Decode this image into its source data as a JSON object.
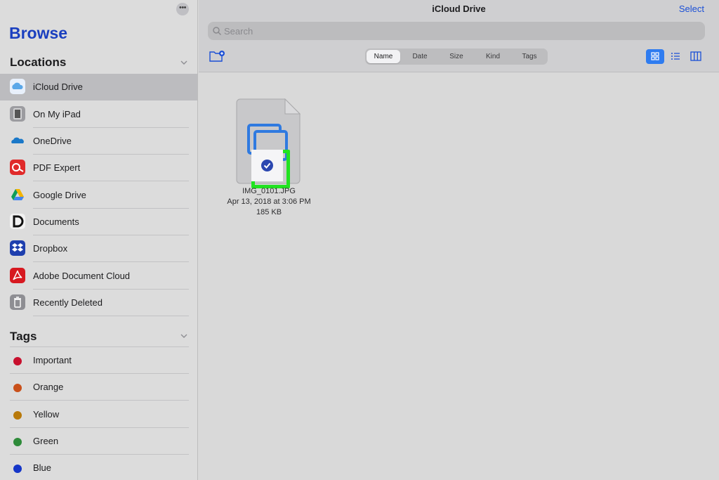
{
  "sidebar": {
    "title": "Browse",
    "locations_title": "Locations",
    "tags_title": "Tags",
    "locations": [
      {
        "label": "iCloud Drive",
        "icon": "icloud-icon",
        "selected": true
      },
      {
        "label": "On My iPad",
        "icon": "ipad-icon",
        "selected": false
      },
      {
        "label": "OneDrive",
        "icon": "onedrive-icon",
        "selected": false
      },
      {
        "label": "PDF Expert",
        "icon": "pdf-expert-icon",
        "selected": false
      },
      {
        "label": "Google Drive",
        "icon": "google-drive-icon",
        "selected": false
      },
      {
        "label": "Documents",
        "icon": "documents-icon",
        "selected": false
      },
      {
        "label": "Dropbox",
        "icon": "dropbox-icon",
        "selected": false
      },
      {
        "label": "Adobe Document Cloud",
        "icon": "adobe-icon",
        "selected": false
      },
      {
        "label": "Recently Deleted",
        "icon": "trash-icon",
        "selected": false
      }
    ],
    "tags": [
      {
        "label": "Important",
        "color": "#c8102e"
      },
      {
        "label": "Orange",
        "color": "#c9501a"
      },
      {
        "label": "Yellow",
        "color": "#b8790a"
      },
      {
        "label": "Green",
        "color": "#2e8b3a"
      },
      {
        "label": "Blue",
        "color": "#1536c8"
      }
    ]
  },
  "header": {
    "title": "iCloud Drive",
    "select_label": "Select",
    "search_placeholder": "Search",
    "sort_options": [
      "Name",
      "Date",
      "Size",
      "Kind",
      "Tags"
    ],
    "active_sort": "Name",
    "active_view": "grid"
  },
  "files": [
    {
      "name": "IMG_0101.JPG",
      "date": "Apr 13, 2018 at 3:06 PM",
      "size": "185 KB",
      "selected": true
    }
  ],
  "colors": {
    "accent": "#2f7cf0",
    "highlight": "#21e321",
    "brand_title": "#1a3fbf"
  }
}
